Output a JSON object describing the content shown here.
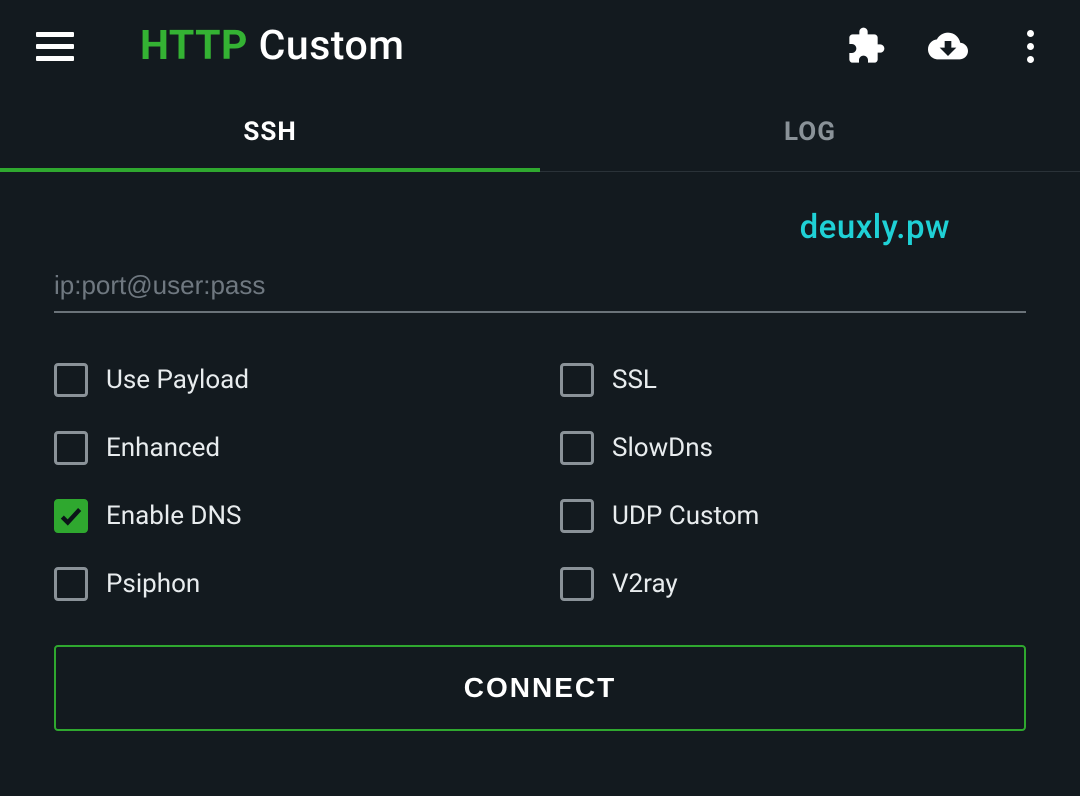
{
  "header": {
    "title_accent": "HTTP",
    "title_rest": " Custom"
  },
  "tabs": {
    "ssh": "SSH",
    "log": "LOG",
    "active": "ssh"
  },
  "watermark": "deuxly.pw",
  "input": {
    "value": "",
    "placeholder": "ip:port@user:pass"
  },
  "options": [
    {
      "id": "use-payload",
      "label": "Use Payload",
      "checked": false
    },
    {
      "id": "ssl",
      "label": "SSL",
      "checked": false
    },
    {
      "id": "enhanced",
      "label": "Enhanced",
      "checked": false
    },
    {
      "id": "slowdns",
      "label": "SlowDns",
      "checked": false
    },
    {
      "id": "enable-dns",
      "label": "Enable DNS",
      "checked": true
    },
    {
      "id": "udp-custom",
      "label": "UDP Custom",
      "checked": false
    },
    {
      "id": "psiphon",
      "label": "Psiphon",
      "checked": false
    },
    {
      "id": "v2ray",
      "label": "V2ray",
      "checked": false
    }
  ],
  "connect_label": "CONNECT",
  "colors": {
    "accent_green": "#2fa82f",
    "watermark_cyan": "#1fd1d6",
    "background": "#131a1f"
  }
}
